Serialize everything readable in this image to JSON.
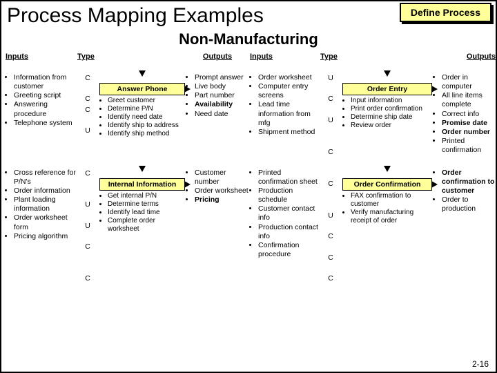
{
  "header": {
    "main_title": "Process Mapping Examples",
    "define_box": "Define Process",
    "sub_title": "Non-Manufacturing"
  },
  "column_headers": {
    "inputs": "Inputs",
    "type": "Type",
    "outputs": "Outputs"
  },
  "processes": [
    {
      "name": "Answer Phone",
      "inputs": [
        "Information from customer",
        "Greeting script",
        "Answering procedure",
        "Telephone system"
      ],
      "input_types": [
        "C",
        "C",
        "C",
        "U"
      ],
      "steps": [
        "Greet customer",
        "Determine P/N",
        "Identify need date",
        "Identify ship to address",
        "Identify ship method"
      ],
      "outputs": [
        "Prompt answer",
        "Live body",
        "Part number",
        "Availability",
        "Need date"
      ],
      "output_bold": [
        false,
        false,
        false,
        true,
        false
      ]
    },
    {
      "name": "Order Entry",
      "inputs": [
        "Order worksheet",
        "Computer entry screens",
        "Lead time information from mfg",
        "Shipment method"
      ],
      "input_types": [
        "U",
        "C",
        "U",
        "C"
      ],
      "steps": [
        "Input information",
        "Print order confirmation",
        "Determine ship date",
        "Review order"
      ],
      "outputs": [
        "Order in computer",
        "All line items complete",
        "Correct info",
        "Promise date",
        "Order number",
        "Printed confirmation"
      ],
      "output_bold": [
        false,
        false,
        false,
        true,
        true,
        false
      ]
    },
    {
      "name": "Internal Information",
      "inputs": [
        "Cross reference for P/N's",
        "Order information",
        "Plant loading information",
        "Order worksheet form",
        "Pricing algorithm"
      ],
      "input_types": [
        "C",
        "U",
        "U",
        "C",
        "C"
      ],
      "steps": [
        "Get internal P/N",
        "Determine terms",
        "Identify lead time",
        "Complete order worksheet"
      ],
      "outputs": [
        "Customer number",
        "Order worksheet",
        "Pricing"
      ],
      "output_bold": [
        false,
        false,
        true
      ]
    },
    {
      "name": "Order Confirmation",
      "inputs": [
        "Printed confirmation sheet",
        "Production schedule",
        "Customer contact info",
        "Production contact info",
        "Confirmation procedure"
      ],
      "input_types": [
        "C",
        "U",
        "C",
        "C",
        "C"
      ],
      "steps": [
        "FAX confirmation to customer",
        "Verify manufacturing receipt of order"
      ],
      "outputs": [
        "Order confirmation to customer",
        "Order to production"
      ],
      "output_bold": [
        true,
        false
      ]
    }
  ],
  "footer": "2-16"
}
